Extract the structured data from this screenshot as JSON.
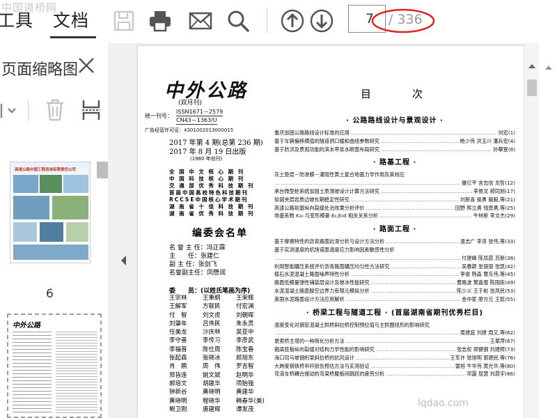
{
  "toolbar": {
    "tab_tools": "工具",
    "tab_document": "文档",
    "current_page": "7",
    "total_pages": "/ 336",
    "icons": [
      "save-icon",
      "print-icon",
      "email-icon",
      "search-icon",
      "arrow-up-circle-icon",
      "arrow-down-circle-icon"
    ]
  },
  "watermark_top": "中国道桥网",
  "watermark_bottom": "lqdao.com",
  "sidebar": {
    "title": "页面缩略图",
    "thumb_label": "6",
    "thumb1_heading": "高速公路中国工程咨询有限责任公司"
  },
  "page": {
    "logo": "中外公路",
    "frequency": "(双月刊)",
    "issn_label": "统一刊号：",
    "issn": "ISSN1671－2579",
    "cn": "CN43－1363/U",
    "ad_license": "广告经营许可证：4301002013000015",
    "issue_line1": "2017 年第 4 期(总第 236 期)",
    "issue_line2": "2017 年 8 月 19 日出版",
    "issue_line3": "(1980 年创刊)",
    "ranks": [
      "全 国 中 文 核 心 期 刊",
      "中 国 科 技 核 心 期 刊",
      "交 通 部 优 秀 科 技 期 刊",
      "首届中国高校特色科技期刊",
      "RCCSE中国核心学术期刊",
      "湖 南 省 十 佳 科 技 期 刊",
      "湖 南 省 优 秀 科 技 期 刊"
    ],
    "committee_title": "编委会名单",
    "roles": [
      "名 誉 主 任：冯正霖",
      "主　　任：张建仁",
      "副 主 任：张剑飞",
      "名誉副主任：凤懋润"
    ],
    "members_label": "委　　员：(以姓氏笔画为序)",
    "members": [
      "王宗林",
      "王秉纲",
      "王荣辉",
      "王解军",
      "方联民",
      "付宏渊",
      "付　智",
      "刘文虎",
      "刘朝晖",
      "刘肇年",
      "吕伟民",
      "朱永灵",
      "任美龙",
      "沙庆林",
      "吴亚中",
      "李守善",
      "李传习",
      "李彦武",
      "李福普",
      "陈仕周",
      "陈宝春",
      "张起森",
      "张晓冰",
      "郎旭东",
      "肖　鹏",
      "周　伟",
      "罗吉智",
      "郑皆连",
      "姚文斌",
      "赵明华",
      "郝培文",
      "胡建华",
      "项贻强",
      "钟新谷",
      "黄晓明",
      "黄建华",
      "黄晓明",
      "程晓华",
      "韩春华(美)",
      "鲍卫刚",
      "唐建辉",
      "谭发茂"
    ],
    "toc_title": "目　次",
    "sections": [
      {
        "title": "· 公路路线设计与景观设计 ·",
        "entries": [
          {
            "t": "重庆加固公路路线设计标准的应用",
            "a": "刘宏(1)"
          },
          {
            "t": "基于车辆偏移横值的隧道洞口缓和曲线参数研究",
            "a": "杨少伟 洪玉川 潘兵宏(4)"
          },
          {
            "t": "基于防洪及景观功能的滨水带亲水断面布局研究",
            "a": "孙攀登(8)"
          }
        ]
      },
      {
        "title": "· 路基工程 ·",
        "entries": [
          {
            "t": "灰土垫层－防渗膜－灌阻性黄土复合地基力学作用及其效应",
            "a": ""
          },
          {
            "t": "",
            "a": "雒亿平 言志信 龙哲(12)"
          },
          {
            "t": "承台微型桩系统加固土质滑坡设计计算方法研究",
            "a": "李易龙 郝同旭(17)"
          },
          {
            "t": "软弱夹层岩质边坡长期稳定性研究",
            "a": "刘新喜 侯勇 戴毅,等(21)"
          },
          {
            "t": "高速公路软基纵向裂缝处治效果分析评价",
            "a": "田野 熊立勇 钱恩勇,等(25)"
          },
          {
            "t": "地基系数 K₃₀ 与变形模量 E₀,E₀d 相关关系分析",
            "a": "牛林新 李文杰(29)"
          }
        ]
      },
      {
        "title": "· 路面工程 ·",
        "entries": [
          {
            "t": "基于摩擦特性的沥青路面抗滑分析与设计方法分析",
            "a": "温志广 李泽 张伟,等(33)"
          },
          {
            "t": "基于实测温度的机场道面温度应力影响因素敏感性分析",
            "a": ""
          },
          {
            "t": "",
            "a": "付建峰 陈凤晨 苏新(38)"
          },
          {
            "t": "利用智能碾压系统评价沥青路面碾压均匀性方法研究",
            "a": "吴春颖 张丽丽 张凯(42)"
          },
          {
            "t": "植石水泥混凝土路面噪声特性分析",
            "a": "李俊 韩森 曹东伟,等(45)"
          },
          {
            "t": "路面低模量弹性铺装层设计及玻冰性能研究",
            "a": "曹路波 樊嘉蛋 陈国栋(49)"
          },
          {
            "t": "水泥混凝土路面脱空边界力有限元模拟分析",
            "a": "陈少义 王于彬 张凤民(53)"
          },
          {
            "t": "英国水泥路面设计方法应用解析",
            "a": "金中家 廖方元 王乾(55)"
          }
        ]
      },
      {
        "title": "· 桥梁工程与隧道工程 · (首届湖南省期刊优秀栏目)",
        "entries": [
          {
            "t": "温度变化对钢管混凝土拱桥斜拉桥控制预拉值与主拱圈线形的影响研究",
            "a": ""
          },
          {
            "t": "",
            "a": "周建庭 刘建 周又,等(62)"
          },
          {
            "t": "悬索桥主塔的一种简化分析方法",
            "a": "王翠萍(67)"
          },
          {
            "t": "箱梁底板纵向裂缝对结构力学性能的影响研究",
            "a": "张志权 郑健钢 刘建辉(73)"
          },
          {
            "t": "海口司马坡钢桁架斜拉桥的抗风设计",
            "a": "王军许 张旭明 郭建民,等(76)"
          },
          {
            "t": "大跨度钢铁桥吊杆损伤预估方法与实测验证",
            "a": "雷旭 牛华伟 黄光华,等(80)"
          },
          {
            "t": "弯道车桥耦合振动的弯梁桥腹板间跳跃的疲劳分析",
            "a": "邓露 屈慧 刘晨宇(86)"
          }
        ]
      }
    ]
  }
}
